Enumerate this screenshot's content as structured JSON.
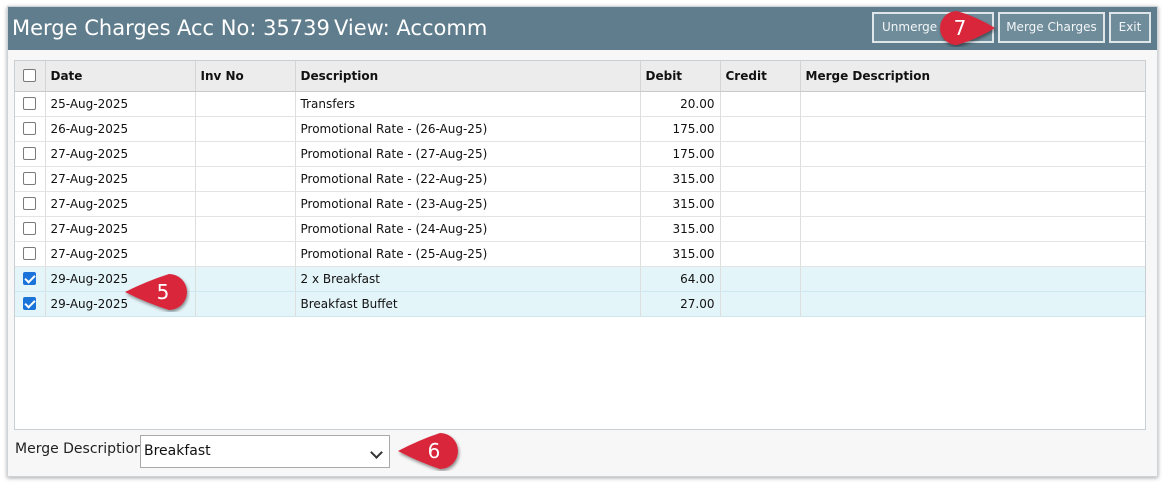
{
  "header": {
    "title": "Merge Charges",
    "account": "Acc No: 35739",
    "view": "View: Accomm",
    "buttons": {
      "unmerge": "Unmerge",
      "merge": "Merge Charges",
      "exit": "Exit"
    }
  },
  "table": {
    "columns": [
      "Date",
      "Inv No",
      "Description",
      "Debit",
      "Credit",
      "Merge Description"
    ],
    "rows": [
      {
        "checked": false,
        "date": "25-Aug-2025",
        "inv": "",
        "desc": "Transfers",
        "debit": "20.00",
        "credit": "",
        "merge": ""
      },
      {
        "checked": false,
        "date": "26-Aug-2025",
        "inv": "",
        "desc": "Promotional Rate - (26-Aug-25)",
        "debit": "175.00",
        "credit": "",
        "merge": ""
      },
      {
        "checked": false,
        "date": "27-Aug-2025",
        "inv": "",
        "desc": "Promotional Rate - (27-Aug-25)",
        "debit": "175.00",
        "credit": "",
        "merge": ""
      },
      {
        "checked": false,
        "date": "27-Aug-2025",
        "inv": "",
        "desc": "Promotional Rate - (22-Aug-25)",
        "debit": "315.00",
        "credit": "",
        "merge": ""
      },
      {
        "checked": false,
        "date": "27-Aug-2025",
        "inv": "",
        "desc": "Promotional Rate - (23-Aug-25)",
        "debit": "315.00",
        "credit": "",
        "merge": ""
      },
      {
        "checked": false,
        "date": "27-Aug-2025",
        "inv": "",
        "desc": "Promotional Rate - (24-Aug-25)",
        "debit": "315.00",
        "credit": "",
        "merge": ""
      },
      {
        "checked": false,
        "date": "27-Aug-2025",
        "inv": "",
        "desc": "Promotional Rate - (25-Aug-25)",
        "debit": "315.00",
        "credit": "",
        "merge": ""
      },
      {
        "checked": true,
        "date": "29-Aug-2025",
        "inv": "",
        "desc": "2 x Breakfast",
        "debit": "64.00",
        "credit": "",
        "merge": ""
      },
      {
        "checked": true,
        "date": "29-Aug-2025",
        "inv": "",
        "desc": "Breakfast Buffet",
        "debit": "27.00",
        "credit": "",
        "merge": ""
      }
    ]
  },
  "footer": {
    "label": "Merge Description",
    "selected": "Breakfast"
  },
  "callouts": {
    "step5": "5",
    "step6": "6",
    "step7": "7"
  },
  "colors": {
    "titlebar": "#5f7d8c",
    "selected_row": "#e4f5fa",
    "callout": "#d9283a",
    "checkbox_checked": "#1a73d9"
  }
}
